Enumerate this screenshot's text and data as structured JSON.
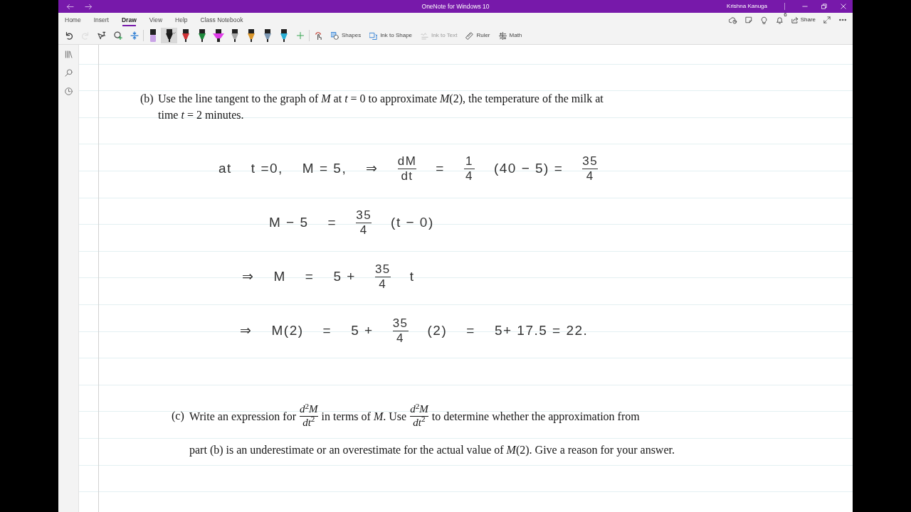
{
  "window": {
    "title": "OneNote for Windows 10",
    "user": "Krishna Kanuga"
  },
  "ribbon": {
    "tabs": [
      {
        "label": "Home",
        "selected": false
      },
      {
        "label": "Insert",
        "selected": false
      },
      {
        "label": "Draw",
        "selected": true
      },
      {
        "label": "View",
        "selected": false
      },
      {
        "label": "Help",
        "selected": false
      },
      {
        "label": "Class Notebook",
        "selected": false
      }
    ],
    "notifications": "6",
    "share_label": "Share",
    "actions": [
      {
        "kind": "undo",
        "disabled": false
      },
      {
        "kind": "redo",
        "disabled": true
      },
      {
        "kind": "type-select",
        "disabled": false
      },
      {
        "kind": "lasso",
        "disabled": false
      },
      {
        "kind": "add-space",
        "disabled": false
      }
    ],
    "pens": [
      {
        "kind": "marker",
        "color": "#c9a3e6",
        "selected": false
      },
      {
        "kind": "pen",
        "color": "#1a1a1a",
        "selected": true
      },
      {
        "kind": "pen",
        "color": "#d13438",
        "selected": false
      },
      {
        "kind": "pen",
        "color": "#1e8a3c",
        "selected": false
      },
      {
        "kind": "highlighter",
        "color": "#e03ce8",
        "selected": false
      },
      {
        "kind": "pen",
        "color": "#a8a8a8",
        "selected": false
      },
      {
        "kind": "pen",
        "color": "#d9962b",
        "selected": false
      },
      {
        "kind": "pen",
        "color": "#7b97b3",
        "selected": false
      },
      {
        "kind": "pen",
        "color": "#2bb0d6",
        "selected": false
      }
    ],
    "tools": [
      {
        "kind": "touch",
        "disabled": false
      },
      {
        "kind": "shapes",
        "label": "Shapes",
        "disabled": false
      },
      {
        "kind": "ink-to-shape",
        "label": "Ink to Shape",
        "disabled": false
      },
      {
        "kind": "ink-to-text",
        "label": "Ink to Text",
        "disabled": true
      },
      {
        "kind": "ruler",
        "label": "Ruler",
        "disabled": false
      },
      {
        "kind": "math",
        "label": "Math",
        "disabled": false
      }
    ]
  },
  "page": {
    "question_b": {
      "label": "(b)",
      "text": "Use the line tangent to the graph of *M* at *t* = 0 to approximate *M*(2), the temperature of the milk at time *t* = 2 minutes."
    },
    "handwriting": [
      {
        "tokens": [
          {
            "kind": "text",
            "text": "at"
          },
          {
            "kind": "text",
            "text": "t =0,"
          },
          {
            "kind": "text",
            "text": "M = 5,"
          },
          {
            "kind": "text",
            "text": "⇒"
          },
          {
            "kind": "frac",
            "num": "dM",
            "den": "dt"
          },
          {
            "kind": "text",
            "text": "="
          },
          {
            "kind": "frac",
            "num": "1",
            "den": "4"
          },
          {
            "kind": "text",
            "text": "(40 − 5) ="
          },
          {
            "kind": "frac",
            "num": "35",
            "den": "4"
          }
        ]
      },
      {
        "tokens": [
          {
            "kind": "text",
            "text": "M − 5"
          },
          {
            "kind": "text",
            "text": "="
          },
          {
            "kind": "frac",
            "num": "35",
            "den": "4"
          },
          {
            "kind": "text",
            "text": "(t − 0)"
          }
        ]
      },
      {
        "tokens": [
          {
            "kind": "text",
            "text": "⇒"
          },
          {
            "kind": "text",
            "text": "M"
          },
          {
            "kind": "text",
            "text": "="
          },
          {
            "kind": "text",
            "text": "5 +"
          },
          {
            "kind": "frac",
            "num": "35",
            "den": "4"
          },
          {
            "kind": "text",
            "text": "t"
          }
        ]
      },
      {
        "tokens": [
          {
            "kind": "text",
            "text": "⇒"
          },
          {
            "kind": "text",
            "text": "M(2)"
          },
          {
            "kind": "text",
            "text": "="
          },
          {
            "kind": "text",
            "text": "5 +"
          },
          {
            "kind": "frac",
            "num": "35",
            "den": "4"
          },
          {
            "kind": "text",
            "text": "(2)"
          },
          {
            "kind": "text",
            "text": "="
          },
          {
            "kind": "text",
            "text": "5+ 17.5 = 22."
          }
        ]
      }
    ],
    "question_c": {
      "label": "(c)",
      "lines": [
        {
          "segments": [
            {
              "kind": "text",
              "text": "Write an expression for"
            },
            {
              "kind": "frac",
              "num": "*d*$^{2}$*M*",
              "den": "*dt*$^{2}$"
            },
            {
              "kind": "text",
              "text": "in terms of *M*. Use"
            },
            {
              "kind": "frac",
              "num": "*d*$^{2}$*M*",
              "den": "*dt*$^{2}$"
            },
            {
              "kind": "text",
              "text": "to determine whether the approximation from"
            }
          ]
        },
        {
          "segments": [
            {
              "kind": "text",
              "text": "part (b) is an underestimate or an overestimate for the actual value of *M*(2). Give a reason for your answer."
            }
          ]
        }
      ]
    }
  }
}
